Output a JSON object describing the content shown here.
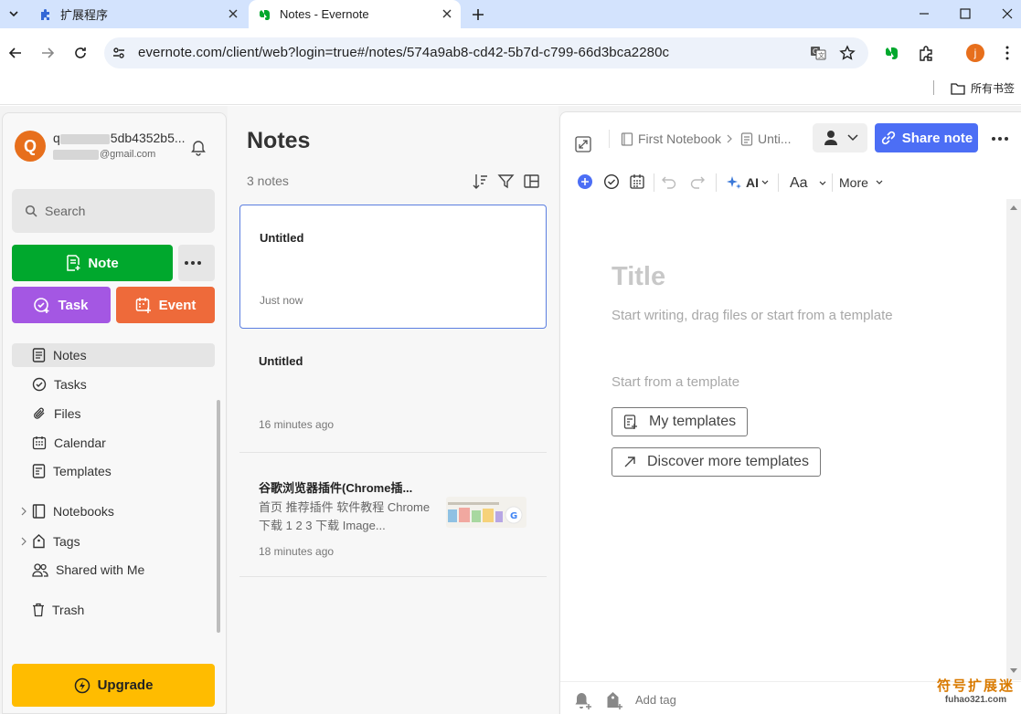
{
  "browser": {
    "tabs": [
      {
        "title": "扩展程序",
        "icon": "puzzle-icon"
      },
      {
        "title": "Notes - Evernote",
        "icon": "evernote-icon"
      }
    ],
    "url": "evernote.com/client/web?login=true#/notes/574a9ab8-cd42-5b7d-c799-66d3bca2280c",
    "profile_initial": "j",
    "bookmarks_folder": "所有书签"
  },
  "account": {
    "initial": "Q",
    "name_suffix": "5db4352b5...",
    "name_prefix": "q",
    "email_suffix": "@gmail.com"
  },
  "sidebar": {
    "search_label": "Search",
    "note_label": "Note",
    "task_label": "Task",
    "event_label": "Event",
    "items": [
      {
        "label": "Notes",
        "icon": "notes-icon"
      },
      {
        "label": "Tasks",
        "icon": "tasks-icon"
      },
      {
        "label": "Files",
        "icon": "paperclip-icon"
      },
      {
        "label": "Calendar",
        "icon": "calendar-icon"
      },
      {
        "label": "Templates",
        "icon": "templates-icon"
      },
      {
        "label": "Notebooks",
        "icon": "notebook-icon"
      },
      {
        "label": "Tags",
        "icon": "tag-icon"
      },
      {
        "label": "Shared with Me",
        "icon": "shared-icon"
      },
      {
        "label": "Trash",
        "icon": "trash-icon"
      }
    ],
    "upgrade_label": "Upgrade"
  },
  "notelist": {
    "title": "Notes",
    "count": "3 notes",
    "notes": [
      {
        "title": "Untitled",
        "time": "Just now",
        "snippet": ""
      },
      {
        "title": "Untitled",
        "time": "16 minutes ago",
        "snippet": ""
      },
      {
        "title": "谷歌浏览器插件(Chrome插...",
        "snippet_line1": "首页 推荐插件 软件教程 Chrome",
        "snippet_line2": "下载 1 2 3 下载 Image...",
        "time": "18 minutes ago"
      }
    ]
  },
  "editor": {
    "breadcrumb_notebook": "First Notebook",
    "breadcrumb_note": "Unti...",
    "share_label": "Share note",
    "ai_label": "AI",
    "font_label": "Aa",
    "more_label": "More",
    "title_placeholder": "Title",
    "body_placeholder": "Start writing, drag files or start from a template",
    "template_heading": "Start from a template",
    "my_templates_label": "My templates",
    "discover_label": "Discover more templates",
    "add_tag_label": "Add tag"
  },
  "watermark": {
    "line1": "符号扩展迷",
    "line2": "fuhao321.com"
  },
  "colors": {
    "note_green": "#00a82d",
    "task_purple": "#a457e3",
    "event_orange": "#ee6a3a",
    "upgrade_yellow": "#ffbc00",
    "share_blue": "#4c6ef5"
  }
}
